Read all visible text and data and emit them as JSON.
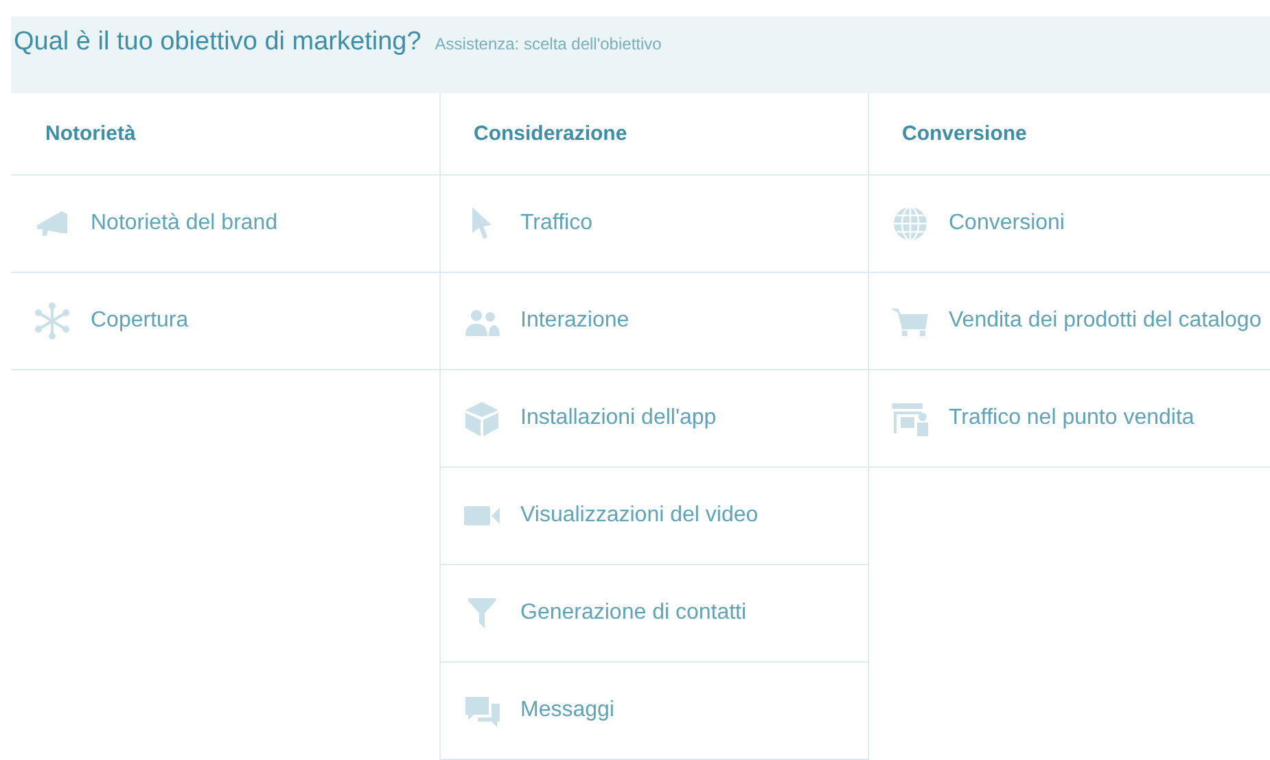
{
  "header": {
    "title": "Qual è il tuo obiettivo di marketing?",
    "help_link": "Assistenza: scelta dell'obiettivo"
  },
  "columns": [
    {
      "heading": "Notorietà",
      "items": [
        {
          "label": "Notorietà del brand"
        },
        {
          "label": "Copertura"
        }
      ]
    },
    {
      "heading": "Considerazione",
      "items": [
        {
          "label": "Traffico"
        },
        {
          "label": "Interazione"
        },
        {
          "label": "Installazioni dell'app"
        },
        {
          "label": "Visualizzazioni del video"
        },
        {
          "label": "Generazione di contatti"
        },
        {
          "label": "Messaggi"
        }
      ]
    },
    {
      "heading": "Conversione",
      "items": [
        {
          "label": "Conversioni"
        },
        {
          "label": "Vendita dei prodotti del catalogo"
        },
        {
          "label": "Traffico nel punto vendita"
        }
      ]
    }
  ]
}
